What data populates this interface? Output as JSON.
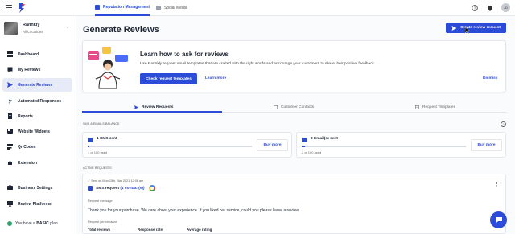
{
  "topbar": {
    "tabs": [
      {
        "label": "Reputation Management",
        "active": true
      },
      {
        "label": "Social Media",
        "active": false
      }
    ],
    "user_initials": "JD"
  },
  "sidebar": {
    "account": {
      "name": "Rannkly",
      "sub": "All Locations"
    },
    "items": [
      {
        "label": "Dashboard",
        "icon": "dashboard-icon"
      },
      {
        "label": "My Reviews",
        "icon": "reviews-icon"
      },
      {
        "label": "Generate Reviews",
        "icon": "send-icon",
        "active": true
      },
      {
        "label": "Automated Responses",
        "icon": "bolt-icon"
      },
      {
        "label": "Reports",
        "icon": "report-icon"
      },
      {
        "label": "Website Widgets",
        "icon": "widget-icon"
      },
      {
        "label": "Qr Codes",
        "icon": "qr-icon"
      },
      {
        "label": "Extension",
        "icon": "puzzle-icon"
      },
      {
        "label": "Business Settings",
        "icon": "settings-icon"
      },
      {
        "label": "Review Platforms",
        "icon": "platform-icon"
      }
    ],
    "plan": {
      "prefix": "You have a ",
      "plan": "BASIC",
      "suffix": " plan"
    }
  },
  "main": {
    "title": "Generate Reviews",
    "create_button": "Create review request",
    "promo": {
      "heading": "Learn how to ask for reviews",
      "text": "Use Rannkly request email templates that are crafted with the right words and encourage your customers to share their positive feedback.",
      "check_button": "Check request templates",
      "learn_more": "Learn more",
      "dismiss": "Dismiss"
    },
    "tabs": [
      {
        "label": "Review Requests",
        "active": true
      },
      {
        "label": "Customer Contacts",
        "active": false
      },
      {
        "label": "Request Templates",
        "active": false
      }
    ],
    "balance_label": "SMS & EMAILS BALANCE",
    "balance": [
      {
        "title": "1  SMS sent",
        "used": "1 of 100 used",
        "fraction": 0.01,
        "buy": "Buy more"
      },
      {
        "title": "2  Email(s) sent",
        "used": "2 of 100 used",
        "fraction": 0.02,
        "buy": "Buy more"
      }
    ],
    "active_label": "ACTIVE REQUESTS",
    "request": {
      "sent": "Sent on Mon 15th, Mar 2021 12:06 am",
      "type": "SMS request",
      "contacts": "(1 contact(s))",
      "message_label": "Request message",
      "message": "Thank you for your purchase. We care about your experience. If you liked our service, could you please leave a review",
      "performance_label": "Request performance",
      "headers": [
        "Total reviews",
        "Response rate",
        "Average rating"
      ]
    }
  },
  "colors": {
    "accent": "#2c4bd8",
    "active_bg": "#e7ebf8"
  }
}
